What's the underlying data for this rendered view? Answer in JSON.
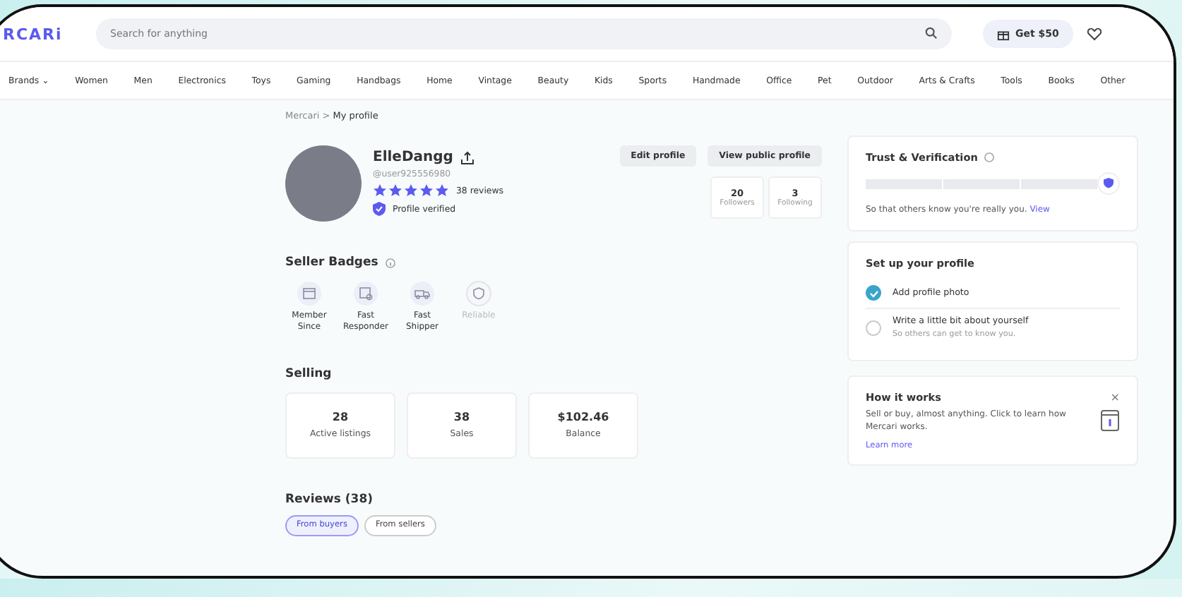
{
  "header": {
    "logo": "RCARi",
    "search": {
      "placeholder": "Search for anything"
    },
    "promo": "Get $50"
  },
  "nav": [
    "Brands ⌄",
    "Women",
    "Men",
    "Electronics",
    "Toys",
    "Gaming",
    "Handbags",
    "Home",
    "Vintage",
    "Beauty",
    "Kids",
    "Sports",
    "Handmade",
    "Office",
    "Pet",
    "Outdoor",
    "Arts & Crafts",
    "Tools",
    "Books",
    "Other"
  ],
  "breadcrumb": [
    "Mercari",
    "My profile"
  ],
  "breadcrumb_separator": ">",
  "profile": {
    "name": "ElleDangg",
    "handle": "@user925556980",
    "stars": 5,
    "reviews": "38 reviews",
    "verified": "Profile verified",
    "buttons": [
      "Edit profile",
      "View public profile"
    ],
    "stats": [
      {
        "value": "20",
        "label": "Followers"
      },
      {
        "value": "3",
        "label": "Following"
      }
    ]
  },
  "seller_badges": {
    "title": "Seller Badges",
    "items": [
      {
        "kind": "calendar",
        "label": "Member Since",
        "earned": true
      },
      {
        "kind": "chat",
        "label": "Fast Responder",
        "earned": true
      },
      {
        "kind": "truck",
        "label": "Fast Shipper",
        "earned": true
      },
      {
        "kind": "shield",
        "label": "Reliable",
        "earned": false
      }
    ]
  },
  "selling": {
    "title": "Selling",
    "cards": [
      {
        "value": "28",
        "label": "Active listings"
      },
      {
        "value": "38",
        "label": "Sales"
      },
      {
        "value": "$102.46",
        "label": "Balance"
      }
    ]
  },
  "reviews": {
    "title": "Reviews (38)",
    "tabs": [
      {
        "label": "From buyers",
        "selected": true
      },
      {
        "label": "From sellers",
        "selected": false
      }
    ]
  },
  "trust": {
    "title": "Trust & Verification",
    "steps": [
      {
        "done": false
      },
      {
        "done": false
      },
      {
        "done": false
      }
    ],
    "text": "So that others know you're really you.",
    "link": "View"
  },
  "setup": {
    "title": "Set up your profile",
    "steps": [
      {
        "title": "Add profile photo",
        "checked": true
      },
      {
        "title": "Write a little bit about yourself",
        "subtitle": "So others can get to know you.",
        "checked": false
      }
    ]
  },
  "how": {
    "title": "How it works",
    "text": "Sell or buy, almost anything. Click to learn how Mercari works.",
    "link": "Learn more",
    "close": "×"
  }
}
